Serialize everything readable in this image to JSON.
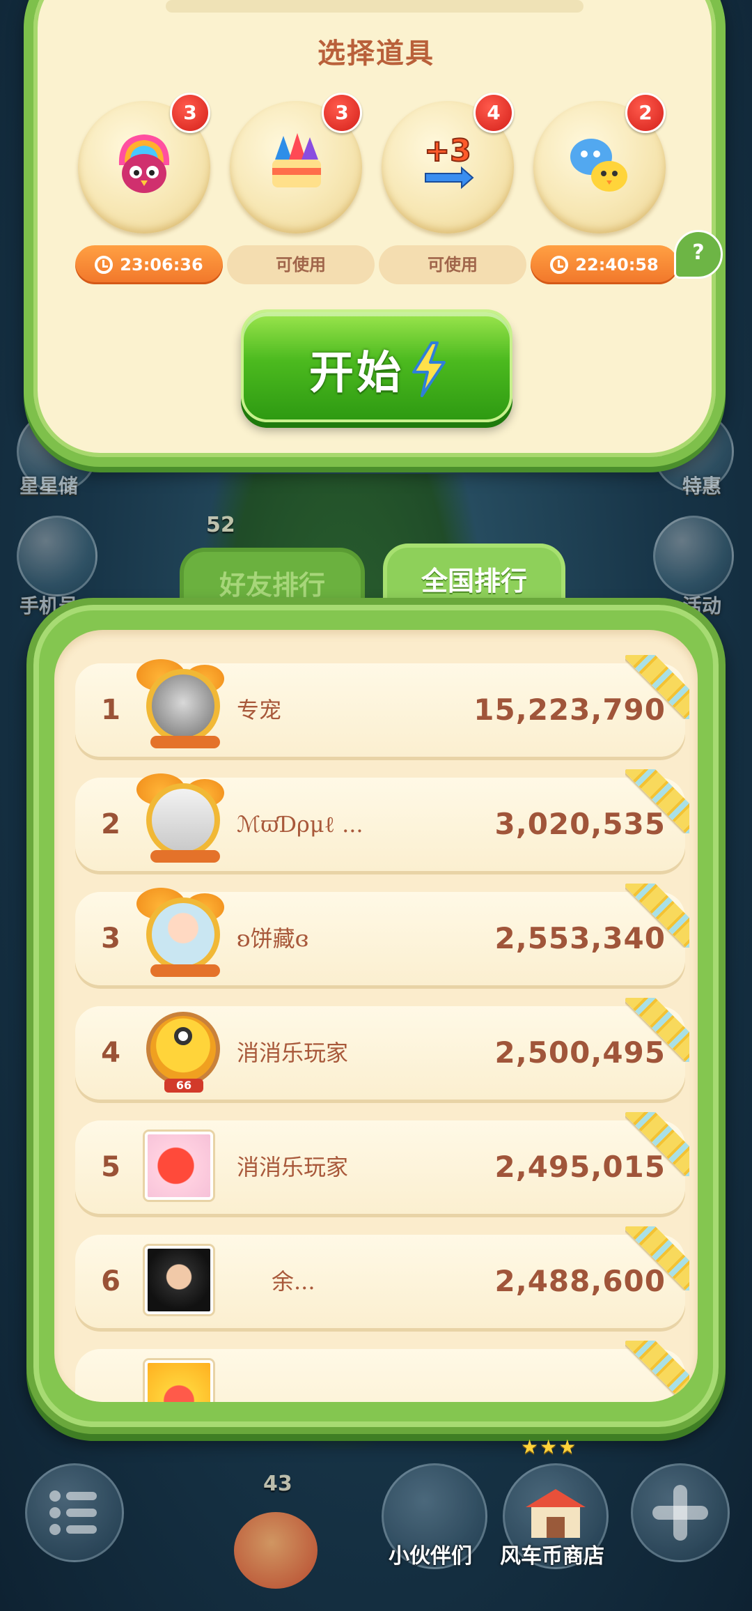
{
  "items_panel": {
    "title": "选择道具",
    "items": [
      {
        "icon": "rainbow-bird-icon",
        "count": "3",
        "status": "23:06:36",
        "status_type": "timer"
      },
      {
        "icon": "firework-box-icon",
        "count": "3",
        "status": "可使用",
        "status_type": "available"
      },
      {
        "icon": "plus-three-steps-icon",
        "count": "4",
        "status": "可使用",
        "status_type": "available"
      },
      {
        "icon": "animal-swap-icon",
        "count": "2",
        "status": "22:40:58",
        "status_type": "timer"
      }
    ],
    "help": "?",
    "start_label": "开始"
  },
  "background": {
    "left_labels": [
      "星星储",
      "手机号"
    ],
    "right_labels": [
      "特惠",
      "活动"
    ],
    "level_numbers": [
      "52",
      "43"
    ]
  },
  "tabs": {
    "friends": "好友排行",
    "national": "全国排行",
    "active": "national"
  },
  "leaderboard": [
    {
      "rank": "1",
      "name": "专宠",
      "score": "15,223,790"
    },
    {
      "rank": "2",
      "name": "ℳϖƊρμℓ ...",
      "score": "3,020,535"
    },
    {
      "rank": "3",
      "name": "ʚ饼藏ɞ",
      "score": "2,553,340"
    },
    {
      "rank": "4",
      "name": "消消乐玩家",
      "score": "2,500,495",
      "avatar_level": "66"
    },
    {
      "rank": "5",
      "name": "消消乐玩家",
      "score": "2,495,015"
    },
    {
      "rank": "6",
      "name": "余...",
      "score": "2,488,600"
    }
  ],
  "bottom_bar": {
    "partners_label": "小伙伴们",
    "shop_label": "风车币商店",
    "shop_stars": "★★★"
  },
  "colors": {
    "panel_green": "#7ec04b",
    "cream": "#fbf2cf",
    "start_green": "#4cba1f",
    "timer_orange": "#f1762a",
    "badge_red": "#d4201a",
    "score_brown": "#a0553a"
  }
}
